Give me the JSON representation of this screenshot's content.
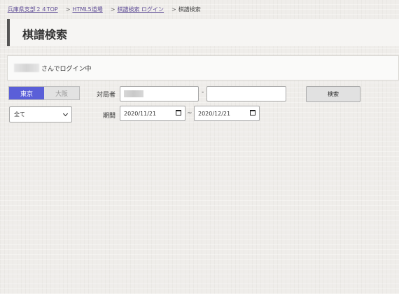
{
  "breadcrumbs": [
    {
      "label": "兵庫県支部２４TOP"
    },
    {
      "label": "HTML5道場"
    },
    {
      "label": "棋譜検索 ログイン"
    }
  ],
  "breadcrumb_current": "棋譜検索",
  "breadcrumb_separator": ">",
  "page": {
    "title": "棋譜検索"
  },
  "login": {
    "status": "さんでログイン中"
  },
  "region": {
    "options": [
      "東京",
      "大阪"
    ],
    "selected": "東京"
  },
  "form": {
    "opponent_label": "対局者",
    "opponent_sep": "-",
    "period_label": "期間",
    "period_sep": "~",
    "date_from": "2020/11/21",
    "date_to": "2020/12/21",
    "filter_selected": "全て",
    "search_label": "検索"
  },
  "colors": {
    "accent": "#5a5fd8",
    "link": "#5f4d96"
  }
}
